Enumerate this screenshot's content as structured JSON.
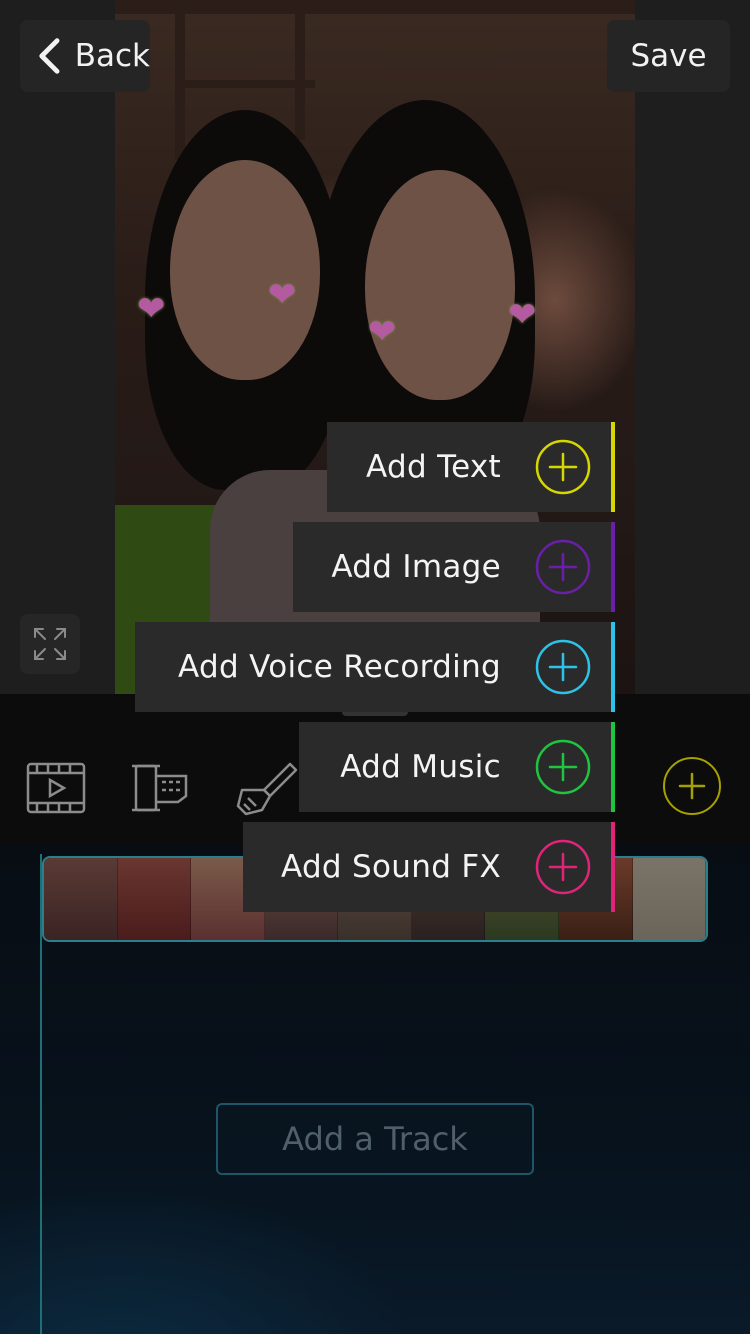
{
  "header": {
    "back_label": "Back",
    "save_label": "Save"
  },
  "toolbar": {
    "tools": [
      {
        "name": "video-clip-icon"
      },
      {
        "name": "film-transition-icon"
      },
      {
        "name": "brush-effects-icon"
      }
    ],
    "add_icon": "plus-circle-icon"
  },
  "menu": {
    "items": [
      {
        "label": "Add Text",
        "color": "#d6d600"
      },
      {
        "label": "Add Image",
        "color": "#6a1fa8"
      },
      {
        "label": "Add Voice Recording",
        "color": "#2fc2e8"
      },
      {
        "label": "Add Music",
        "color": "#1fc441"
      },
      {
        "label": "Add Sound FX",
        "color": "#e0247a"
      }
    ]
  },
  "timeline": {
    "add_track_label": "Add a Track"
  },
  "colors": {
    "accent_teal": "#2b7f8c",
    "toolbar_add": "#a6a000"
  }
}
